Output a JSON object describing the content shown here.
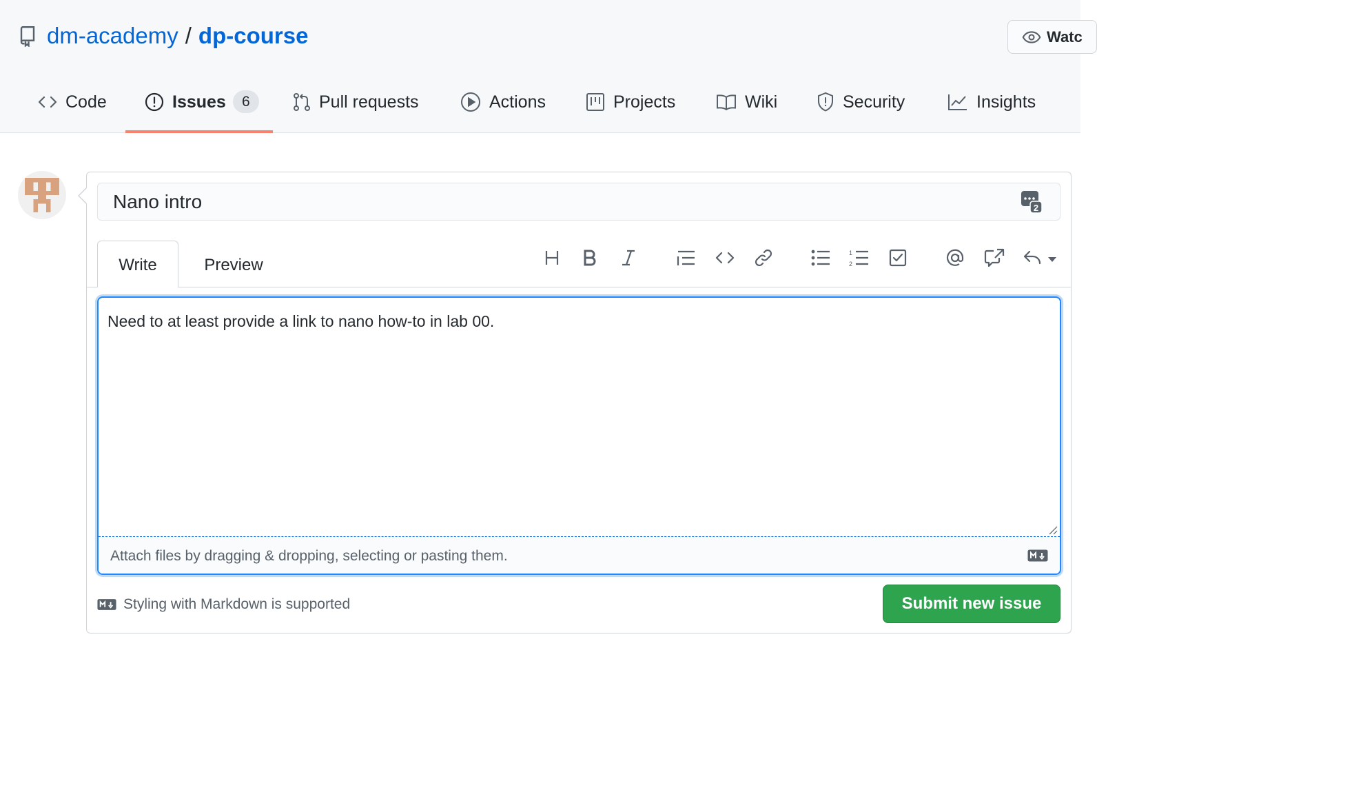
{
  "repo": {
    "owner": "dm-academy",
    "separator": "/",
    "name": "dp-course",
    "icon": "repo-icon"
  },
  "watch_button": {
    "label": "Watc",
    "icon": "eye-icon"
  },
  "nav_tabs": [
    {
      "label": "Code",
      "icon": "code-icon"
    },
    {
      "label": "Issues",
      "icon": "issue-opened-icon",
      "counter": "6",
      "selected": true
    },
    {
      "label": "Pull requests",
      "icon": "git-pull-request-icon"
    },
    {
      "label": "Actions",
      "icon": "play-icon"
    },
    {
      "label": "Projects",
      "icon": "project-icon"
    },
    {
      "label": "Wiki",
      "icon": "book-icon"
    },
    {
      "label": "Security",
      "icon": "shield-icon"
    },
    {
      "label": "Insights",
      "icon": "graph-icon"
    }
  ],
  "issue_form": {
    "title_value": "Nano intro",
    "editor_tabs": {
      "write": "Write",
      "preview": "Preview"
    },
    "toolbar": [
      "heading-icon",
      "bold-icon",
      "italic-icon",
      "quote-icon",
      "code-icon",
      "link-icon",
      "unordered-list-icon",
      "ordered-list-icon",
      "task-list-icon",
      "mention-icon",
      "cross-reference-icon",
      "reply-icon"
    ],
    "body_value": "Need to at least provide a link to nano how-to in lab 00.",
    "attach_text": "Attach files by dragging & dropping, selecting or pasting them.",
    "markdown_hint": "Styling with Markdown is supported",
    "submit_label": "Submit new issue"
  },
  "colors": {
    "link": "#0366d6",
    "selected_tab_underline": "#f9826c",
    "submit_green": "#2ea44f",
    "focus_blue": "#2188ff"
  }
}
